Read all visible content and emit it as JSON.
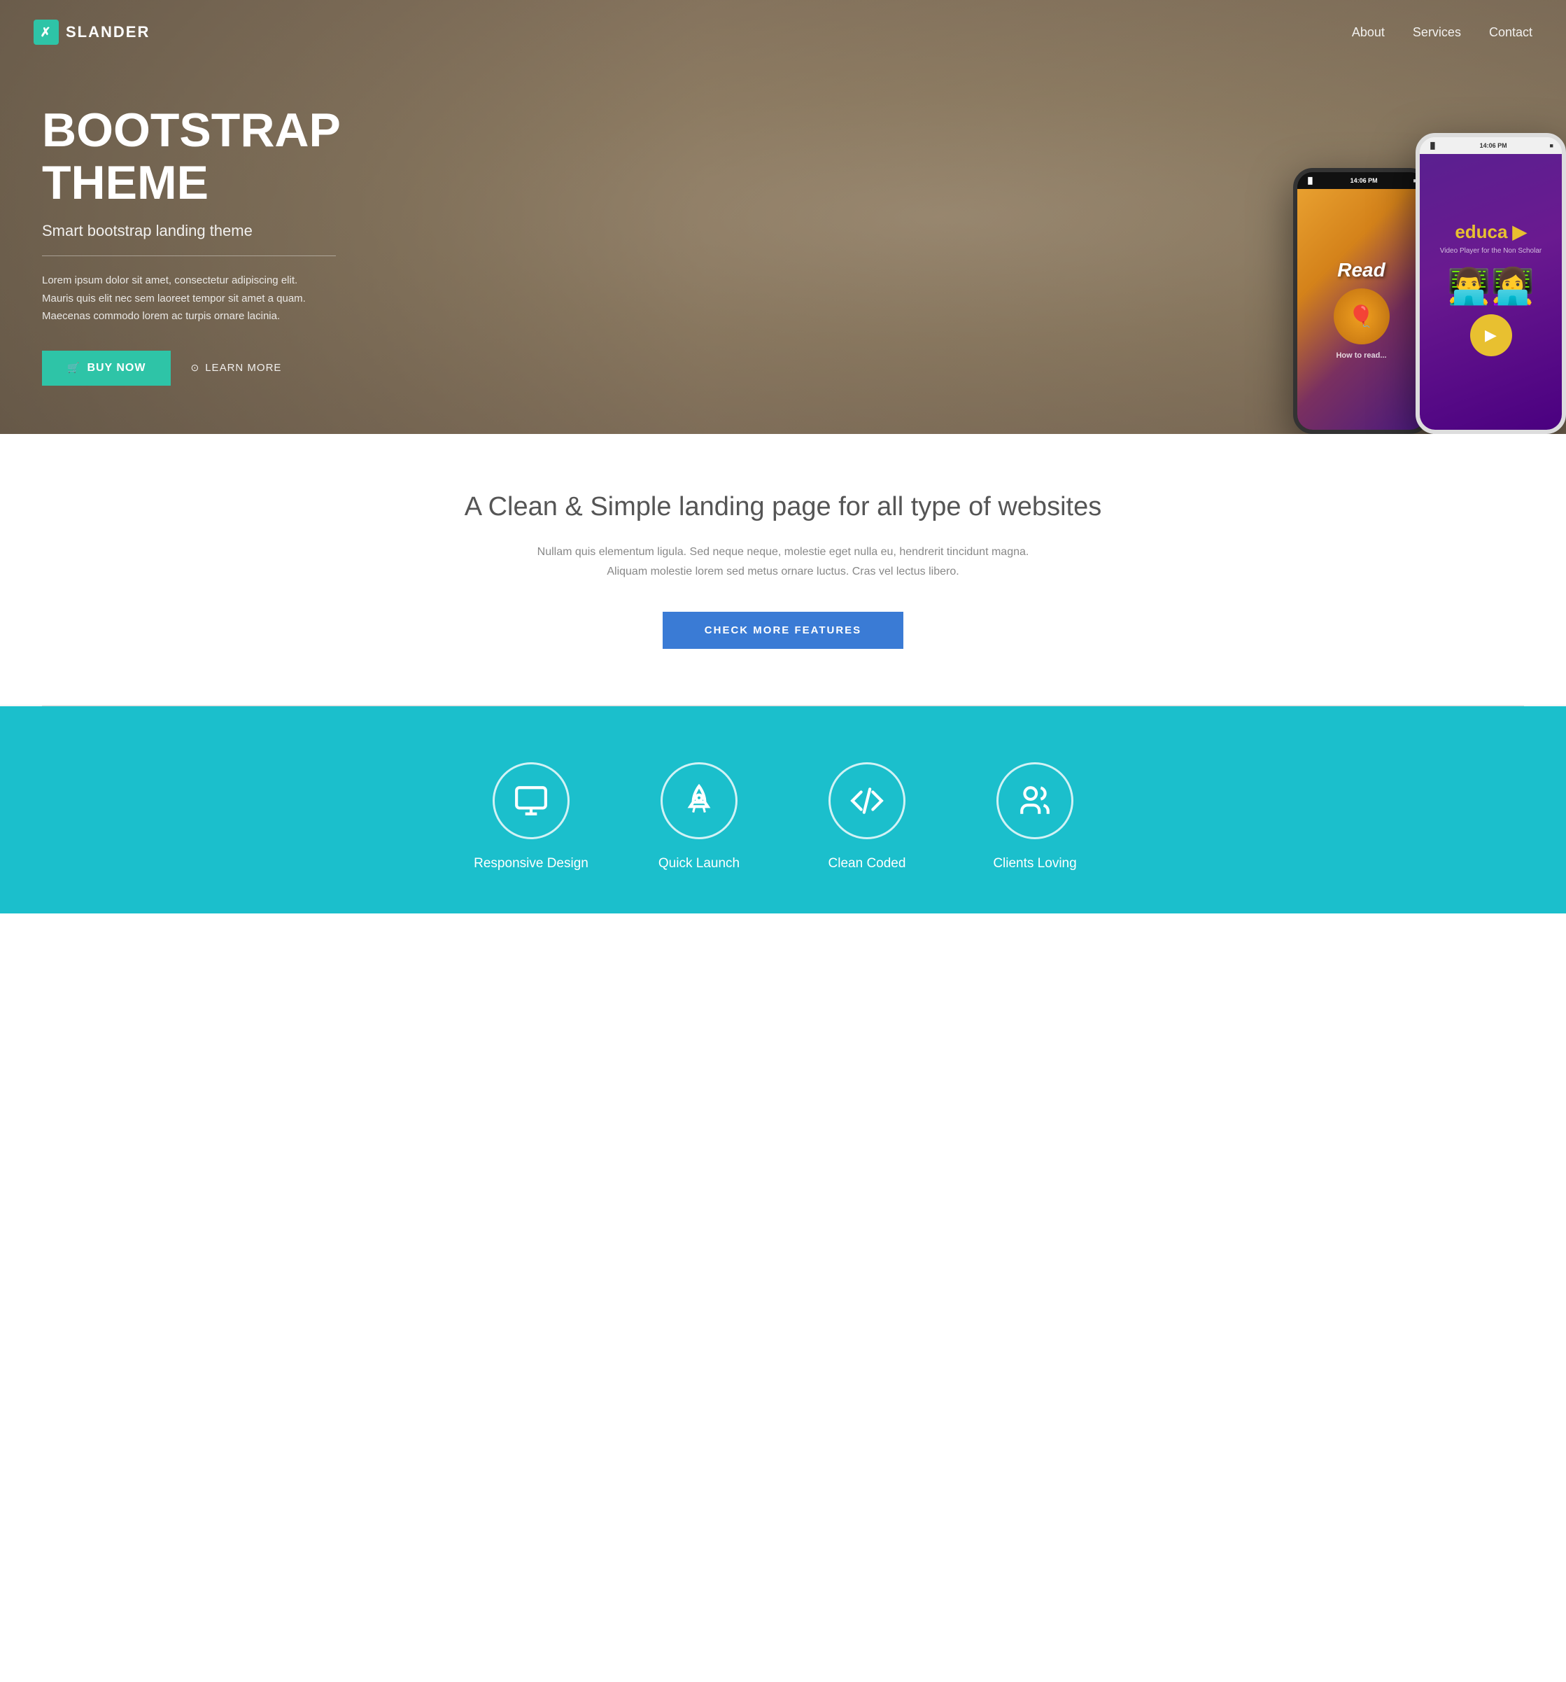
{
  "nav": {
    "logo_text": "SLANDER",
    "logo_icon": "/",
    "links": [
      {
        "label": "About",
        "href": "#about"
      },
      {
        "label": "Services",
        "href": "#services"
      },
      {
        "label": "Contact",
        "href": "#contact"
      }
    ]
  },
  "hero": {
    "title": "BOOTSTRAP THEME",
    "subtitle": "Smart bootstrap landing theme",
    "description": "Lorem ipsum dolor sit amet, consectetur adipiscing elit. Mauris quis elit nec sem laoreet tempor sit amet a quam. Maecenas commodo lorem ac turpis ornare lacinia.",
    "buy_label": "BUY NOW",
    "learn_label": "LEARN MORE",
    "phone_black_time": "14:06 PM",
    "phone_white_time": "14:06 PM"
  },
  "middle": {
    "title": "A Clean & Simple landing page for all type of websites",
    "description": "Nullam quis elementum ligula. Sed neque neque, molestie eget nulla eu, hendrerit tincidunt magna. Aliquam molestie lorem sed metus ornare luctus. Cras vel lectus libero.",
    "cta_label": "CHECK MORE FEATURES"
  },
  "features": [
    {
      "icon": "monitor",
      "label": "Responsive Design"
    },
    {
      "icon": "rocket",
      "label": "Quick Launch"
    },
    {
      "icon": "code",
      "label": "Clean Coded"
    },
    {
      "icon": "users",
      "label": "Clients Loving"
    }
  ],
  "colors": {
    "teal": "#1bbfcc",
    "teal_button": "#2ec4a7",
    "blue_button": "#3a7bd5"
  }
}
